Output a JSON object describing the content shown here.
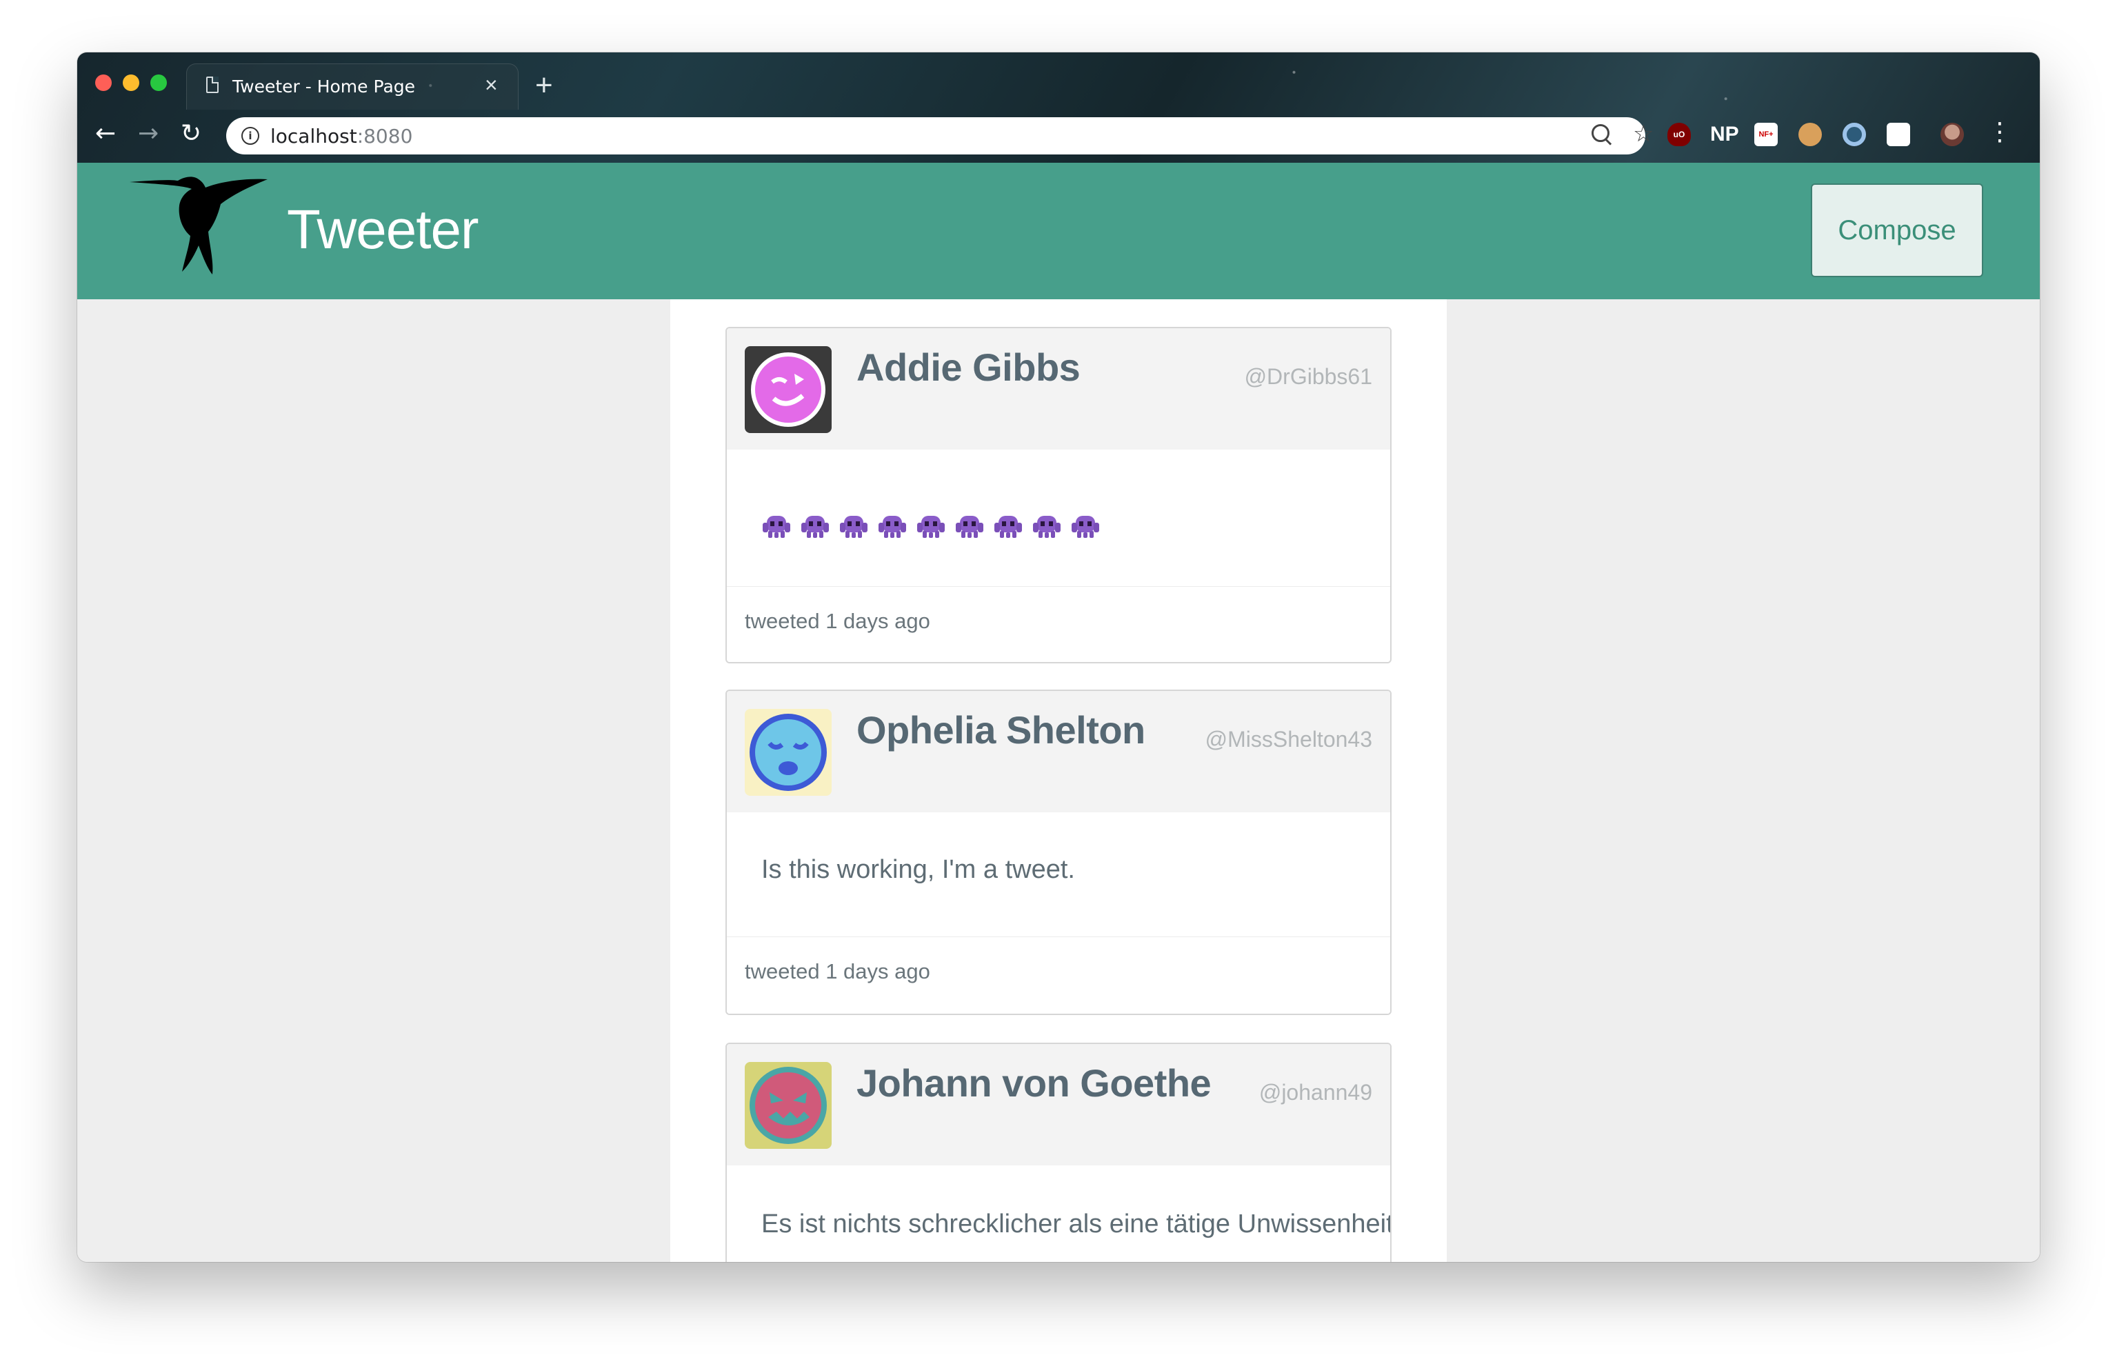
{
  "browser": {
    "tab_title": "Tweeter - Home Page",
    "tab_close": "×",
    "new_tab": "+",
    "url_host": "localhost",
    "url_port": ":8080",
    "back": "←",
    "forward": "→",
    "reload": "↻",
    "extensions": [
      {
        "name": "ublock",
        "label": "uO"
      },
      {
        "name": "np",
        "label": "NP"
      },
      {
        "name": "nf",
        "label": "NF+"
      }
    ]
  },
  "app": {
    "title": "Tweeter",
    "compose_label": "Compose"
  },
  "tweets": [
    {
      "name": "Addie Gibbs",
      "handle": "@DrGibbs61",
      "content": "👾👾👾👾👾👾👾👾👾",
      "emoji_count": 9,
      "timestamp": "tweeted 1 days ago",
      "avatar_bg": "#3a3a3a",
      "avatar_face": "#e36ae8"
    },
    {
      "name": "Ophelia Shelton",
      "handle": "@MissShelton43",
      "content": "Is this working, I'm a tweet.",
      "timestamp": "tweeted 1 days ago",
      "avatar_bg": "#f9f1c4",
      "avatar_face": "#6ec6e8"
    },
    {
      "name": "Johann von Goethe",
      "handle": "@johann49",
      "content": "Es ist nichts schrecklicher als eine tätige Unwissenheit.",
      "avatar_bg": "#d6d478",
      "avatar_face": "#d05a7a"
    }
  ],
  "colors": {
    "header_bg": "#479f8b",
    "page_bg": "#eeeeee",
    "name_text": "#566873",
    "handle_text": "#b2b6b8"
  }
}
